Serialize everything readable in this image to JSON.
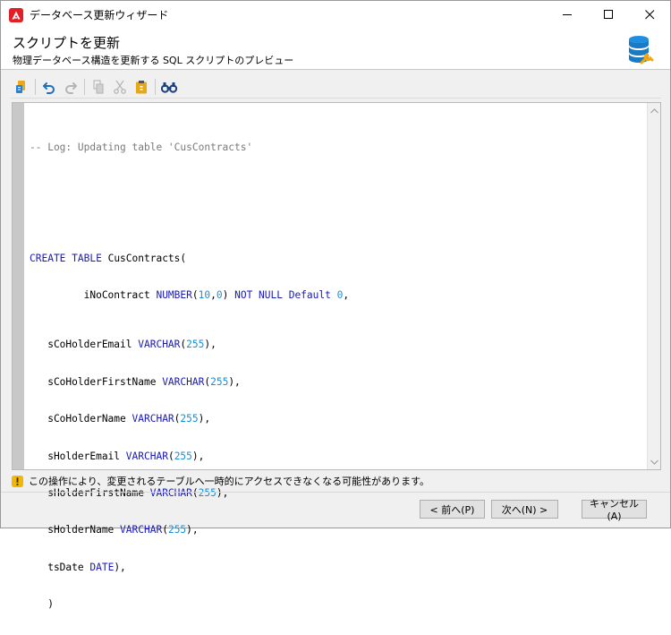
{
  "window": {
    "title": "データベース更新ウィザード"
  },
  "header": {
    "title": "スクリプトを更新",
    "subtitle": "物理データベース構造を更新する SQL スクリプトのプレビュー"
  },
  "toolbar": {
    "icons": [
      "script-icon",
      "undo-icon",
      "redo-icon",
      "copy-icon",
      "cut-icon",
      "paste-icon",
      "find-icon"
    ]
  },
  "code": {
    "comment": "-- Log: Updating table 'CusContracts'",
    "create_kw": "CREATE TABLE",
    "table_name": "CusContracts(",
    "col1_indent": "         iNoContract ",
    "col1_type": "NUMBER",
    "col1_paren_open": "(",
    "col1_p1": "10",
    "col1_comma": ",",
    "col1_p2": "0",
    "col1_paren_close": ") ",
    "col1_constraint": "NOT NULL Default",
    "col1_space": " ",
    "col1_default": "0",
    "col1_end": ",",
    "columns": [
      {
        "name": "   sCoHolderEmail ",
        "type": "VARCHAR",
        "len": "255"
      },
      {
        "name": "   sCoHolderFirstName ",
        "type": "VARCHAR",
        "len": "255"
      },
      {
        "name": "   sCoHolderName ",
        "type": "VARCHAR",
        "len": "255"
      },
      {
        "name": "   sHolderEmail ",
        "type": "VARCHAR",
        "len": "255"
      },
      {
        "name": "   sHolderFirstName ",
        "type": "VARCHAR",
        "len": "255"
      },
      {
        "name": "   sHolderName ",
        "type": "VARCHAR",
        "len": "255"
      }
    ],
    "date_col": "   tsDate ",
    "date_type": "DATE",
    "date_end": "),",
    "close_line": "   )"
  },
  "warning": {
    "text": "この操作により、変更されるテーブルへ一時的にアクセスできなくなる可能性があります。"
  },
  "buttons": {
    "prev": "< 前へ(P)",
    "next": "次へ(N) >",
    "cancel": "キャンセル(A)"
  },
  "colors": {
    "keyword": "#1a1ab5",
    "number": "#1a8fd6",
    "comment": "#7a7a7a",
    "warning": "#f2b705",
    "app_icon": "#e41e25"
  }
}
